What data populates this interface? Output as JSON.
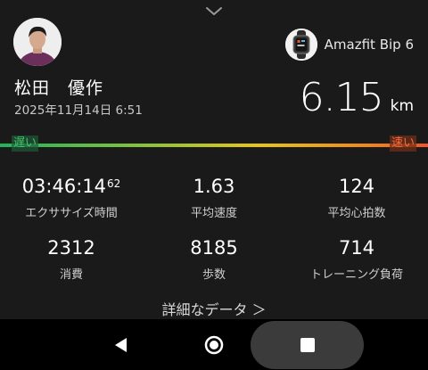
{
  "user": {
    "name": "松田　優作",
    "date": "2025年11月14日 6:51"
  },
  "device": {
    "name": "Amazfit Bip 6",
    "icon": "smartwatch-icon"
  },
  "distance": {
    "value": "6.15",
    "unit": "km"
  },
  "pace_scale": {
    "slow_label": "遅い",
    "fast_label": "速い"
  },
  "stats": [
    {
      "value": "03:46:14",
      "sup": "62",
      "label": "エクササイズ時間"
    },
    {
      "value": "1.63",
      "label": "平均速度"
    },
    {
      "value": "124",
      "label": "平均心拍数"
    },
    {
      "value": "2312",
      "label": "消費"
    },
    {
      "value": "8185",
      "label": "歩数"
    },
    {
      "value": "714",
      "label": "トレーニング負荷"
    }
  ],
  "details_link": "詳細なデータ ＞",
  "colors": {
    "background": "#1a1a1a",
    "slow": "#3ec46d",
    "fast": "#ff6a3a"
  }
}
